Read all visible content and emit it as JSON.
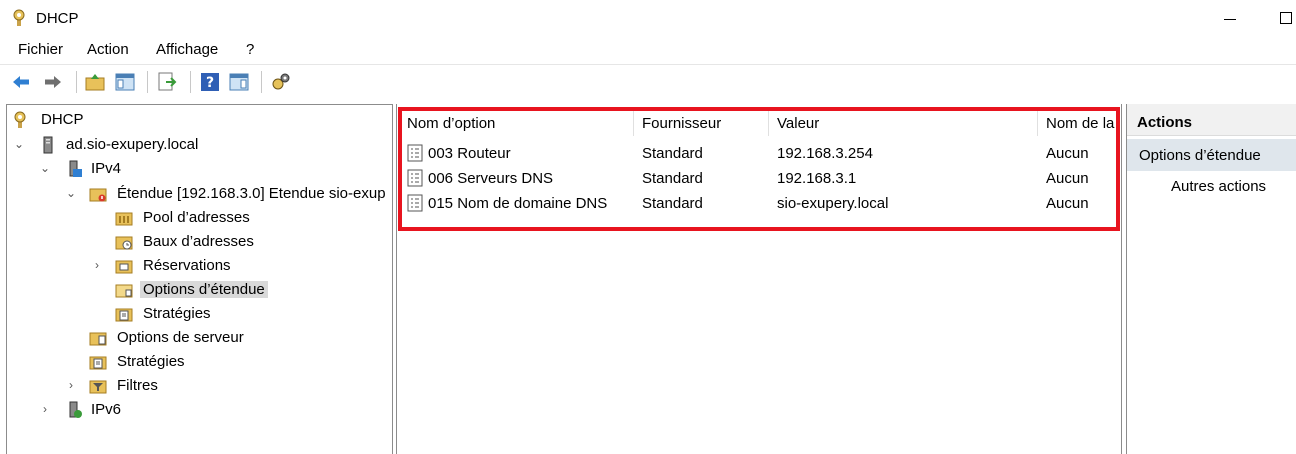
{
  "window": {
    "title": "DHCP"
  },
  "menu": {
    "items": [
      "Fichier",
      "Action",
      "Affichage",
      "?"
    ]
  },
  "toolbar": {
    "icons": [
      "back-arrow-icon",
      "forward-arrow-icon",
      "up-folder-icon",
      "show-hide-tree-icon",
      "export-list-icon",
      "help-icon",
      "action-pane-icon",
      "dhcp-options-icon"
    ]
  },
  "tree": {
    "root": "DHCP",
    "server": "ad.sio-exupery.local",
    "ipv4": "IPv4",
    "scope": "Étendue [192.168.3.0] Etendue sio-exup",
    "pool": "Pool d’adresses",
    "leases": "Baux d’adresses",
    "reservations": "Réservations",
    "scope_options": "Options d’étendue",
    "scope_policies": "Stratégies",
    "server_options": "Options de serveur",
    "server_policies": "Stratégies",
    "filters": "Filtres",
    "ipv6": "IPv6"
  },
  "list": {
    "columns": [
      "Nom d’option",
      "Fournisseur",
      "Valeur",
      "Nom de la"
    ],
    "rows": [
      {
        "name": "003 Routeur",
        "vendor": "Standard",
        "value": "192.168.3.254",
        "class": "Aucun"
      },
      {
        "name": "006 Serveurs DNS",
        "vendor": "Standard",
        "value": "192.168.3.1",
        "class": "Aucun"
      },
      {
        "name": "015 Nom de domaine DNS",
        "vendor": "Standard",
        "value": "sio-exupery.local",
        "class": "Aucun"
      }
    ]
  },
  "actions": {
    "header": "Actions",
    "section": "Options d’étendue",
    "more": "Autres actions"
  },
  "colors": {
    "highlight": "#e8141f",
    "selection": "#d9d9d9",
    "action_section": "#dfe6ec"
  }
}
